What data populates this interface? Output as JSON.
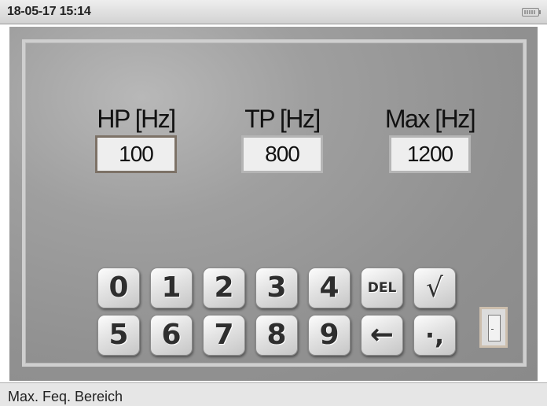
{
  "status": {
    "datetime": "18-05-17 15:14",
    "battery_icon": "battery-icon"
  },
  "params": [
    {
      "label": "HP [Hz]",
      "value": "100"
    },
    {
      "label": "TP [Hz]",
      "value": "800"
    },
    {
      "label": "Max [Hz]",
      "value": "1200"
    }
  ],
  "keypad": {
    "row1": [
      "0",
      "1",
      "2",
      "3",
      "4",
      "DEL",
      "√"
    ],
    "row2": [
      "5",
      "6",
      "7",
      "8",
      "9",
      "←",
      "·,"
    ]
  },
  "bottom": {
    "hint": "Max. Feq. Bereich"
  }
}
